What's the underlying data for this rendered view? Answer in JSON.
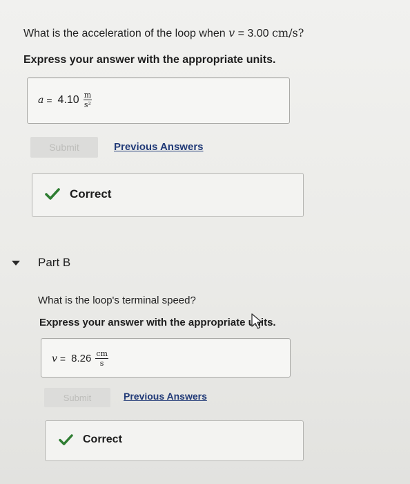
{
  "partA": {
    "question_prefix": "What is the acceleration of the loop when",
    "question_var": "v",
    "question_eq": "= 3.00",
    "question_unit": "cm/s?",
    "instruction": "Express your answer with the appropriate units.",
    "answer": {
      "var": "a",
      "eq": "=",
      "value": "4.10",
      "unit_num": "m",
      "unit_den": "s²"
    },
    "submit_label": "Submit",
    "previous_answers_label": "Previous Answers",
    "result_label": "Correct"
  },
  "partB": {
    "title": "Part B",
    "question": "What is the loop's terminal speed?",
    "instruction": "Express your answer with the appropriate units.",
    "answer": {
      "var": "v",
      "eq": "=",
      "value": "8.26",
      "unit_num": "cm",
      "unit_den": "s"
    },
    "submit_label": "Submit",
    "previous_answers_label": "Previous Answers",
    "result_label": "Correct"
  },
  "colors": {
    "check_green": "#2e7d32",
    "link_blue": "#213a77"
  },
  "icons": [
    "check-icon",
    "caret-down-icon",
    "cursor-arrow-icon"
  ]
}
